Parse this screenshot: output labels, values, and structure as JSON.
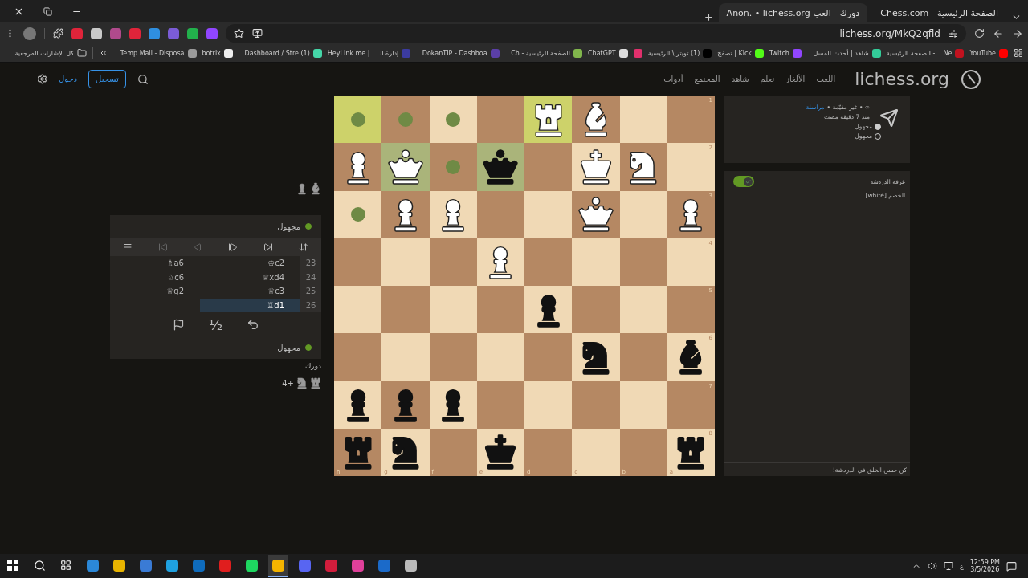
{
  "browser": {
    "tabs": [
      {
        "title": "الصفحة الرئيسية - Chess.com",
        "selected": false
      },
      {
        "title": "دورك - العب Anon. • lichess.org",
        "selected": true
      }
    ],
    "url": "lichess.org/MkQ2qfld",
    "extensions": [
      {
        "color": "#9146ff"
      },
      {
        "color": "#22b14c"
      },
      {
        "color": "#7b5cd6"
      },
      {
        "color": "#2f8fe0"
      },
      {
        "color": "#e0243a"
      },
      {
        "color": "#b04a8c"
      },
      {
        "color": "#c9c9c9"
      },
      {
        "color": "#e0243a"
      }
    ],
    "bookmarks": [
      {
        "title": "YouTube",
        "color": "#ff0000"
      },
      {
        "title": "Ne... - الصفحة الرئيسية",
        "color": "#c1121f"
      },
      {
        "title": "شاهد | أحدث المسل...",
        "color": "#33cc99"
      },
      {
        "title": "Twitch",
        "color": "#9146ff"
      },
      {
        "title": "Kick | تصفح",
        "color": "#53fc18"
      },
      {
        "title": "(1) تويتر \\ الرئيسية",
        "color": "#000000"
      },
      {
        "color": "#e1306c"
      },
      {
        "title": "ChatGPT",
        "color": "#dddddd"
      },
      {
        "title": "الصفحة الرئيسية - Ch...",
        "color": "#81b64c"
      },
      {
        "title": "DokanTIP - Dashboa...",
        "color": "#5b3fa8"
      },
      {
        "title": "إدارة الـ... | HeyLink.me",
        "color": "#3b3ba0"
      },
      {
        "title": "(1) Dashboard / Stre...",
        "color": "#45d6a8"
      },
      {
        "title": "botrix",
        "color": "#eeeeee"
      },
      {
        "title": "Temp Mail - Disposa...",
        "color": "#9a9a9a"
      }
    ],
    "all_bookmarks": "كل الإشارات المرجعية"
  },
  "header": {
    "logo": "lichess.org",
    "nav": [
      "اللعب",
      "الألغاز",
      "تعلم",
      "شاهد",
      "المجتمع",
      "أدوات"
    ],
    "signup": "تسجيل",
    "signin": "دخول"
  },
  "board": {
    "ranks": [
      "1",
      "2",
      "3",
      "4",
      "5",
      "6",
      "7",
      "8"
    ],
    "files": [
      "a",
      "b",
      "c",
      "d",
      "e",
      "f",
      "g",
      "h"
    ],
    "rows": [
      [
        {
          "kind": "empty",
          "last_move": true,
          "selected": false,
          "dot": true
        },
        {
          "kind": "empty",
          "last_move": false,
          "selected": false,
          "dot": true
        },
        {
          "kind": "empty",
          "last_move": false,
          "selected": false,
          "dot": true
        },
        {
          "kind": "empty",
          "last_move": false,
          "selected": false,
          "dot": false
        },
        {
          "kind": "rook",
          "black": false,
          "last_move": true,
          "selected": false,
          "dot": false
        },
        {
          "kind": "bishop",
          "black": false,
          "last_move": false,
          "selected": false,
          "dot": false
        },
        {
          "kind": "empty",
          "last_move": false,
          "selected": false,
          "dot": false
        },
        {
          "kind": "empty",
          "last_move": false,
          "selected": false,
          "dot": false
        }
      ],
      [
        {
          "kind": "pawn",
          "black": false,
          "last_move": false,
          "selected": false,
          "dot": false
        },
        {
          "kind": "queen",
          "black": false,
          "last_move": false,
          "selected": true,
          "dot": false
        },
        {
          "kind": "empty",
          "last_move": false,
          "selected": false,
          "dot": true
        },
        {
          "kind": "queen",
          "black": true,
          "last_move": false,
          "selected": true,
          "dot": false
        },
        {
          "kind": "empty",
          "last_move": false,
          "selected": false,
          "dot": false
        },
        {
          "kind": "king",
          "black": false,
          "last_move": false,
          "selected": false,
          "dot": false
        },
        {
          "kind": "knight",
          "black": false,
          "last_move": false,
          "selected": false,
          "dot": false
        },
        {
          "kind": "empty",
          "last_move": false,
          "selected": false,
          "dot": false
        }
      ],
      [
        {
          "kind": "empty",
          "last_move": false,
          "selected": false,
          "dot": true
        },
        {
          "kind": "pawn",
          "black": false,
          "last_move": false,
          "selected": false,
          "dot": false
        },
        {
          "kind": "pawn",
          "black": false,
          "last_move": false,
          "selected": false,
          "dot": false
        },
        {
          "kind": "empty",
          "last_move": false,
          "selected": false,
          "dot": false
        },
        {
          "kind": "empty",
          "last_move": false,
          "selected": false,
          "dot": false
        },
        {
          "kind": "queen",
          "black": false,
          "last_move": false,
          "selected": false,
          "dot": false
        },
        {
          "kind": "empty",
          "last_move": false,
          "selected": false,
          "dot": false
        },
        {
          "kind": "pawn",
          "black": false,
          "last_move": false,
          "selected": false,
          "dot": false
        }
      ],
      [
        {
          "kind": "empty",
          "last_move": false,
          "selected": false,
          "dot": false
        },
        {
          "kind": "empty",
          "last_move": false,
          "selected": false,
          "dot": false
        },
        {
          "kind": "empty",
          "last_move": false,
          "selected": false,
          "dot": false
        },
        {
          "kind": "pawn",
          "black": false,
          "last_move": false,
          "selected": false,
          "dot": false
        },
        {
          "kind": "empty",
          "last_move": false,
          "selected": false,
          "dot": false
        },
        {
          "kind": "empty",
          "last_move": false,
          "selected": false,
          "dot": false
        },
        {
          "kind": "empty",
          "last_move": false,
          "selected": false,
          "dot": false
        },
        {
          "kind": "empty",
          "last_move": false,
          "selected": false,
          "dot": false
        }
      ],
      [
        {
          "kind": "empty",
          "last_move": false,
          "selected": false,
          "dot": false
        },
        {
          "kind": "empty",
          "last_move": false,
          "selected": false,
          "dot": false
        },
        {
          "kind": "empty",
          "last_move": false,
          "selected": false,
          "dot": false
        },
        {
          "kind": "empty",
          "last_move": false,
          "selected": false,
          "dot": false
        },
        {
          "kind": "pawn",
          "black": true,
          "last_move": false,
          "selected": false,
          "dot": false
        },
        {
          "kind": "empty",
          "last_move": false,
          "selected": false,
          "dot": false
        },
        {
          "kind": "empty",
          "last_move": false,
          "selected": false,
          "dot": false
        },
        {
          "kind": "empty",
          "last_move": false,
          "selected": false,
          "dot": false
        }
      ],
      [
        {
          "kind": "empty",
          "last_move": false,
          "selected": false,
          "dot": false
        },
        {
          "kind": "empty",
          "last_move": false,
          "selected": false,
          "dot": false
        },
        {
          "kind": "empty",
          "last_move": false,
          "selected": false,
          "dot": false
        },
        {
          "kind": "empty",
          "last_move": false,
          "selected": false,
          "dot": false
        },
        {
          "kind": "empty",
          "last_move": false,
          "selected": false,
          "dot": false
        },
        {
          "kind": "knight",
          "black": true,
          "last_move": false,
          "selected": false,
          "dot": false
        },
        {
          "kind": "empty",
          "last_move": false,
          "selected": false,
          "dot": false
        },
        {
          "kind": "bishop",
          "black": true,
          "last_move": false,
          "selected": false,
          "dot": false
        }
      ],
      [
        {
          "kind": "pawn",
          "black": true,
          "last_move": false,
          "selected": false,
          "dot": false
        },
        {
          "kind": "pawn",
          "black": true,
          "last_move": false,
          "selected": false,
          "dot": false
        },
        {
          "kind": "pawn",
          "black": true,
          "last_move": false,
          "selected": false,
          "dot": false
        },
        {
          "kind": "empty",
          "last_move": false,
          "selected": false,
          "dot": false
        },
        {
          "kind": "empty",
          "last_move": false,
          "selected": false,
          "dot": false
        },
        {
          "kind": "empty",
          "last_move": false,
          "selected": false,
          "dot": false
        },
        {
          "kind": "empty",
          "last_move": false,
          "selected": false,
          "dot": false
        },
        {
          "kind": "empty",
          "last_move": false,
          "selected": false,
          "dot": false
        }
      ],
      [
        {
          "kind": "rook",
          "black": true,
          "last_move": false,
          "selected": false,
          "dot": false
        },
        {
          "kind": "knight",
          "black": true,
          "last_move": false,
          "selected": false,
          "dot": false
        },
        {
          "kind": "empty",
          "last_move": false,
          "selected": false,
          "dot": false
        },
        {
          "kind": "king",
          "black": true,
          "last_move": false,
          "selected": false,
          "dot": false
        },
        {
          "kind": "empty",
          "last_move": false,
          "selected": false,
          "dot": false
        },
        {
          "kind": "empty",
          "last_move": false,
          "selected": false,
          "dot": false
        },
        {
          "kind": "empty",
          "last_move": false,
          "selected": false,
          "dot": false
        },
        {
          "kind": "rook",
          "black": true,
          "last_move": false,
          "selected": false,
          "dot": false
        }
      ]
    ]
  },
  "captured_top": [
    {
      "kind": "bishop"
    },
    {
      "kind": "pawn"
    }
  ],
  "game_panel": {
    "top_player": {
      "name": "مجهول",
      "online": true
    },
    "controls": [
      {
        "kind": "flip",
        "disabled": false
      },
      {
        "kind": "last",
        "disabled": false
      },
      {
        "kind": "next",
        "disabled": false
      },
      {
        "kind": "prev",
        "disabled": true
      },
      {
        "kind": "first",
        "disabled": true
      },
      {
        "kind": "menu",
        "disabled": false
      }
    ],
    "moves": [
      {
        "number": "23",
        "white": {
          "san": "♔c2",
          "selected": false
        },
        "black": {
          "san": "♗a6",
          "selected": false
        }
      },
      {
        "number": "24",
        "white": {
          "san": "♕xd4",
          "selected": false
        },
        "black": {
          "san": "♘c6",
          "selected": false
        }
      },
      {
        "number": "25",
        "white": {
          "san": "♕c3",
          "selected": false
        },
        "black": {
          "san": "♕g2",
          "selected": false
        }
      },
      {
        "number": "26",
        "white": {
          "san": "♖d1",
          "selected": true
        }
      }
    ],
    "actions": [
      {
        "kind": "takeback"
      },
      {
        "kind": "draw",
        "label": "½"
      },
      {
        "kind": "resign"
      }
    ],
    "bottom_player": {
      "name": "مجهول",
      "online": true
    }
  },
  "turn_text": "دورك",
  "captured_bottom": {
    "pieces": [
      {
        "kind": "rook"
      },
      {
        "kind": "knight"
      }
    ],
    "score": "+4"
  },
  "game_info": {
    "variant": "∞ • غير مقيّمة •",
    "mode_link": "مراسلة",
    "time": "منذ 7 دقيقة مضت",
    "players": [
      {
        "name": "مجهول",
        "white": true
      },
      {
        "name": "مجهول",
        "white": false
      }
    ]
  },
  "chat": {
    "title": "غرفة الدردشة",
    "on": true,
    "messages": [
      "الخصم [white]"
    ],
    "placeholder": "كن حسن الخلق في الدردشة!"
  },
  "taskbar": {
    "apps": [
      {
        "color": "#2b88d8",
        "selected": false
      },
      {
        "color": "#e8b400",
        "selected": false
      },
      {
        "color": "#3a7bd5",
        "selected": false
      },
      {
        "color": "#1fa1e0",
        "selected": false
      },
      {
        "color": "#0f6cbd",
        "selected": false
      },
      {
        "color": "#e01e1e",
        "selected": false
      },
      {
        "color": "#1ed760",
        "selected": false
      },
      {
        "color": "#f4b400",
        "selected": true
      },
      {
        "color": "#5865f2",
        "selected": false
      },
      {
        "color": "#d21d3c",
        "selected": false
      },
      {
        "color": "#e0409a",
        "selected": false
      },
      {
        "color": "#1b6ac9",
        "selected": false
      },
      {
        "color": "#bbbbbb",
        "selected": false
      }
    ],
    "language": "ع",
    "time": "12:59 PM",
    "date": "3/5/2026"
  }
}
